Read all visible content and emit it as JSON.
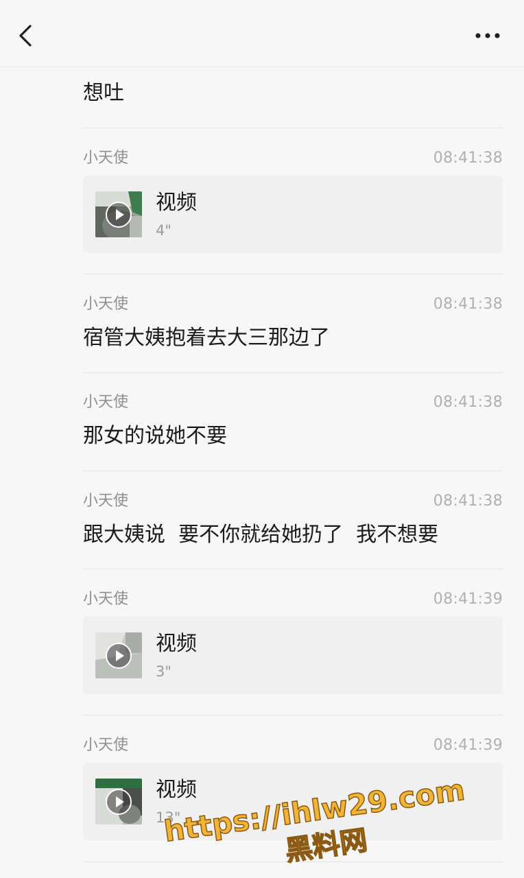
{
  "header": {
    "back_icon": "chevron-left-icon",
    "more_icon": "more-horizontal-icon"
  },
  "first_message": "想吐",
  "records": [
    {
      "sender": "小天使",
      "time": "08:41:38",
      "type": "video",
      "video_label": "视频",
      "duration": "4\""
    },
    {
      "sender": "小天使",
      "time": "08:41:38",
      "type": "text",
      "text": "宿管大姨抱着去大三那边了"
    },
    {
      "sender": "小天使",
      "time": "08:41:38",
      "type": "text",
      "text": "那女的说她不要"
    },
    {
      "sender": "小天使",
      "time": "08:41:38",
      "type": "text",
      "text": "跟大姨说  要不你就给她扔了  我不想要"
    },
    {
      "sender": "小天使",
      "time": "08:41:39",
      "type": "video",
      "video_label": "视频",
      "duration": "3\""
    },
    {
      "sender": "小天使",
      "time": "08:41:39",
      "type": "video",
      "video_label": "视频",
      "duration": "13\""
    }
  ],
  "watermark": {
    "url": "https://ihlw29.com",
    "name": "黑料网",
    "color": "#f0b437"
  }
}
